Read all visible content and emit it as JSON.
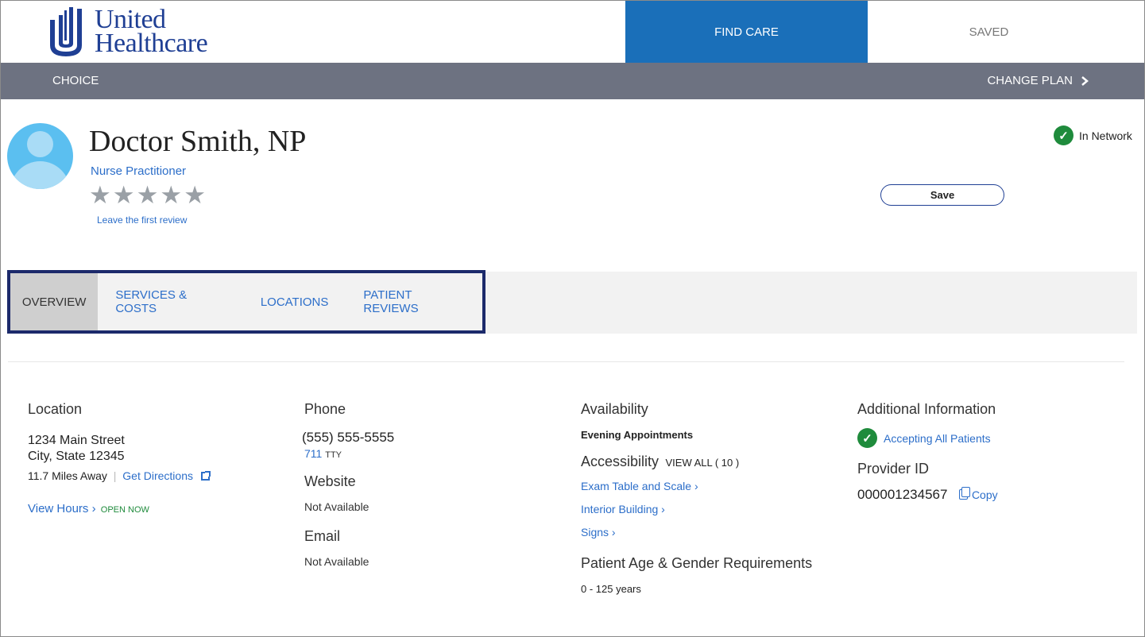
{
  "header": {
    "logo_line1": "United",
    "logo_line2": "Healthcare",
    "nav_find_care": "FIND CARE",
    "nav_saved": "SAVED"
  },
  "plan_bar": {
    "plan_name": "CHOICE",
    "change_plan": "CHANGE PLAN",
    "change_plan_icon": "chevron-right-icon"
  },
  "provider": {
    "name": "Doctor Smith, NP",
    "title": "Nurse Practitioner",
    "rating_stars": 0,
    "star_glyph": "★",
    "first_review": "Leave the first review",
    "network_status": "In Network",
    "save_label": "Save"
  },
  "tabs": [
    {
      "label": "OVERVIEW",
      "active": true
    },
    {
      "label": "SERVICES & COSTS",
      "active": false
    },
    {
      "label": "LOCATIONS",
      "active": false
    },
    {
      "label": "PATIENT REVIEWS",
      "active": false
    }
  ],
  "location": {
    "heading": "Location",
    "address1": "1234 Main Street",
    "address2": "City, State 12345",
    "distance": "11.7 Miles Away",
    "separator": "|",
    "directions": "Get Directions",
    "view_hours": "View Hours",
    "chevron": "›",
    "open_now": "OPEN NOW"
  },
  "contact": {
    "phone_heading": "Phone",
    "phone": "(555) 555-5555",
    "tty_number": "711",
    "tty_label": "TTY",
    "website_heading": "Website",
    "website": "Not Available",
    "email_heading": "Email",
    "email": "Not Available"
  },
  "availability": {
    "heading": "Availability",
    "value": "Evening Appointments",
    "accessibility_heading": "Accessibility",
    "view_all": "VIEW ALL ( 10 )",
    "items": [
      "Exam Table and Scale",
      "Interior Building",
      "Signs"
    ],
    "chevron": "›",
    "age_heading": "Patient Age & Gender Requirements",
    "age_value": "0 - 125 years"
  },
  "additional": {
    "heading": "Additional Information",
    "accepting": "Accepting All Patients",
    "provider_id_heading": "Provider ID",
    "provider_id": "000001234567",
    "copy": "Copy"
  },
  "colors": {
    "brand_blue": "#1f3f94",
    "nav_active": "#1a6fb9",
    "plan_bar": "#6d7281",
    "link": "#2c6ec9",
    "success": "#1f8b3c"
  }
}
